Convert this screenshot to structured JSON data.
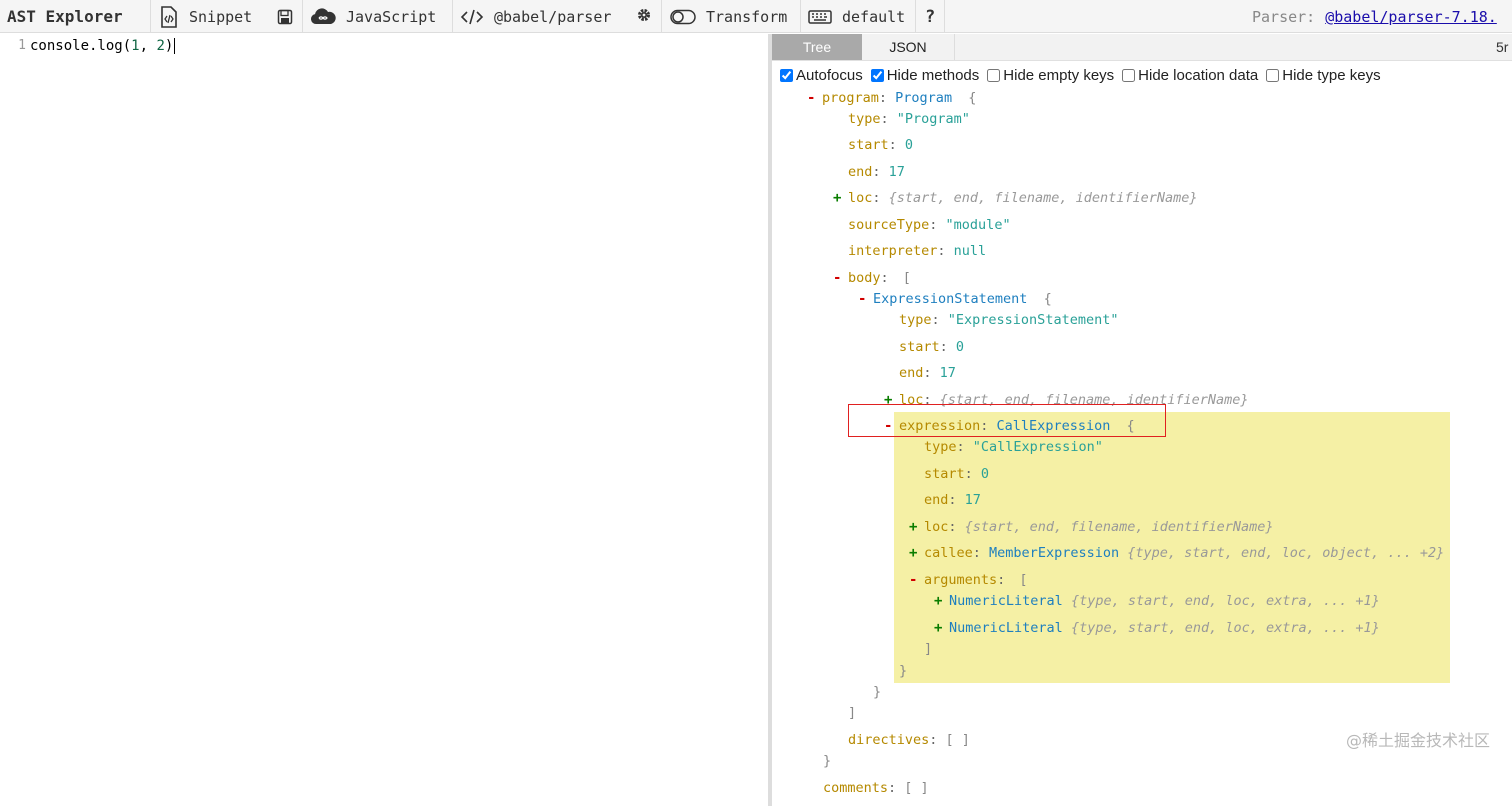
{
  "toolbar": {
    "brand": "AST Explorer",
    "snippet": "Snippet",
    "language": "JavaScript",
    "parser": "@babel/parser",
    "transform": "Transform",
    "keymap": "default",
    "help": "?",
    "parser_label": "Parser:",
    "parser_version": "@babel/parser-7.18."
  },
  "editor": {
    "line_number": "1",
    "code_prefix": "console.log(",
    "arg1": "1",
    "sep": ", ",
    "arg2": "2",
    "code_suffix": ")"
  },
  "output": {
    "tabs": [
      "Tree",
      "JSON"
    ],
    "time": "5r",
    "options": [
      {
        "label": "Autofocus",
        "checked": true
      },
      {
        "label": "Hide methods",
        "checked": true
      },
      {
        "label": "Hide empty keys",
        "checked": false
      },
      {
        "label": "Hide location data",
        "checked": false
      },
      {
        "label": "Hide type keys",
        "checked": false
      }
    ],
    "tree": {
      "program": {
        "key": "program",
        "type": "Program",
        "open": "{"
      },
      "p_type": {
        "key": "type",
        "value": "\"Program\""
      },
      "p_start": {
        "key": "start",
        "value": "0"
      },
      "p_end": {
        "key": "end",
        "value": "17"
      },
      "p_loc": {
        "key": "loc",
        "summary": "{start, end, filename, identifierName}"
      },
      "p_sourceType": {
        "key": "sourceType",
        "value": "\"module\""
      },
      "p_interpreter": {
        "key": "interpreter",
        "value": "null"
      },
      "body": {
        "key": "body",
        "open": "["
      },
      "es": {
        "type": "ExpressionStatement",
        "open": "{"
      },
      "es_type": {
        "key": "type",
        "value": "\"ExpressionStatement\""
      },
      "es_start": {
        "key": "start",
        "value": "0"
      },
      "es_end": {
        "key": "end",
        "value": "17"
      },
      "es_loc": {
        "key": "loc",
        "summary": "{start, end, filename, identifierName}"
      },
      "expr": {
        "key": "expression",
        "type": "CallExpression",
        "open": "{"
      },
      "ce_type": {
        "key": "type",
        "value": "\"CallExpression\""
      },
      "ce_start": {
        "key": "start",
        "value": "0"
      },
      "ce_end": {
        "key": "end",
        "value": "17"
      },
      "ce_loc": {
        "key": "loc",
        "summary": "{start, end, filename, identifierName}"
      },
      "callee": {
        "key": "callee",
        "type": "MemberExpression",
        "summary": "{type, start, end, loc, object, ... +2}"
      },
      "args": {
        "key": "arguments",
        "open": "["
      },
      "arg_a": {
        "type": "NumericLiteral",
        "summary": "{type, start, end, loc, extra, ... +1}"
      },
      "arg_b": {
        "type": "NumericLiteral",
        "summary": "{type, start, end, loc, extra, ... +1}"
      },
      "args_close": "]",
      "expr_close": "}",
      "es_close": "}",
      "body_close": "]",
      "directives": {
        "key": "directives",
        "value": "[ ]"
      },
      "program_close": "}",
      "comments": {
        "key": "comments",
        "value": "[ ]"
      }
    }
  },
  "watermark": "@稀土掘金技术社区"
}
